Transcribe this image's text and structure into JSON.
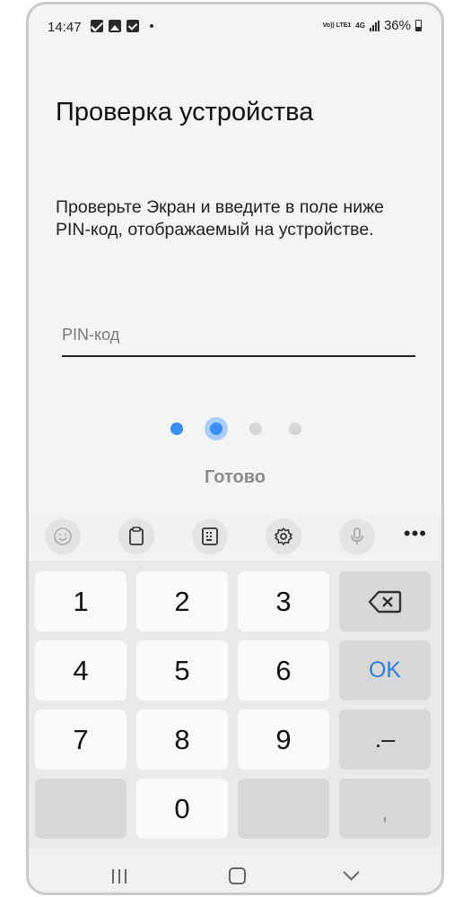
{
  "status_bar": {
    "time": "14:47",
    "notification_icons": [
      "mail-icon",
      "image-icon",
      "check-icon"
    ],
    "volte_label": "Vo)) LTE1",
    "network_label": "4G",
    "battery": "36%"
  },
  "page": {
    "title": "Проверка устройства",
    "description": "Проверьте Экран и введите в поле ниже PIN-код, отображаемый на устройстве.",
    "pin_placeholder": "PIN-код",
    "pin_value": "",
    "done_label": "Готово",
    "progress": {
      "total_steps": 4,
      "current_step": 2
    }
  },
  "keyboard": {
    "toolbar_icons": [
      "emoji-icon",
      "clipboard-icon",
      "keyboard-mode-icon",
      "settings-icon",
      "microphone-icon",
      "more-icon"
    ],
    "keys": {
      "k1": "1",
      "k2": "2",
      "k3": "3",
      "k4": "4",
      "k5": "5",
      "k6": "6",
      "k7": "7",
      "k8": "8",
      "k9": "9",
      "k0": "0",
      "ok": "OK",
      "dot_minus": ".–",
      "comma": ","
    }
  },
  "colors": {
    "accent": "#3b8ff3",
    "ok_text": "#2f7de1",
    "background": "#f4f4f4"
  }
}
